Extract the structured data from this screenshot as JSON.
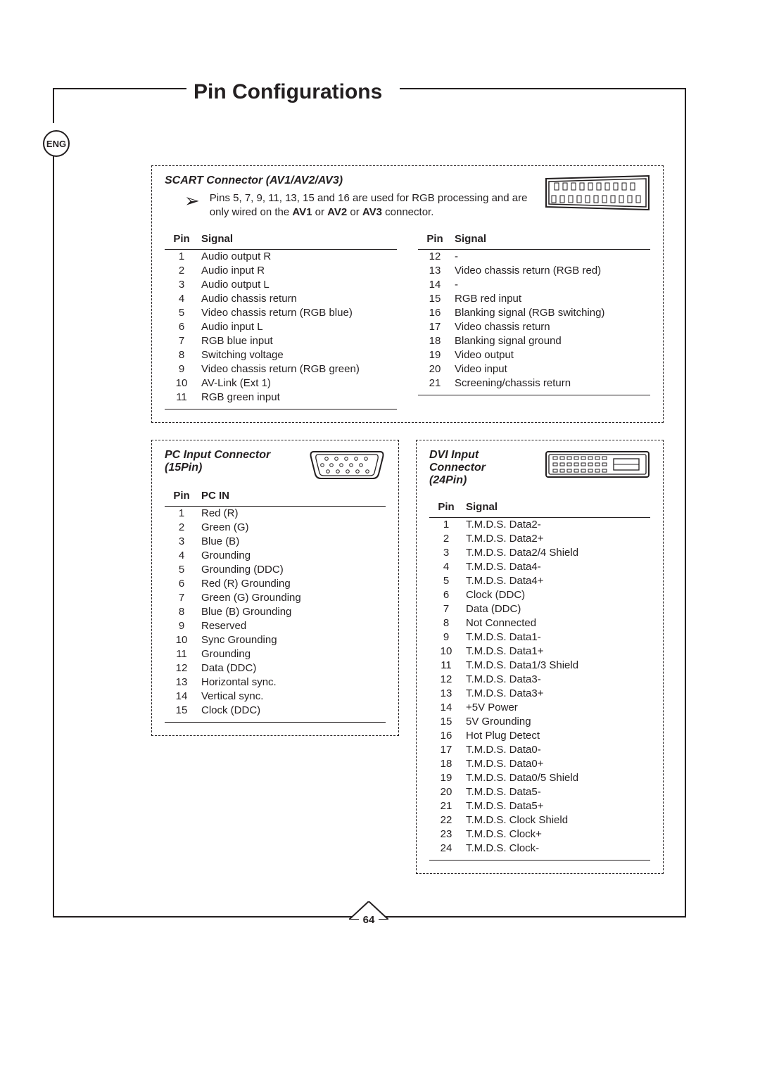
{
  "page_title": "Pin Configurations",
  "language_badge": "ENG",
  "page_number": "64",
  "scart": {
    "title": "SCART Connector (AV1/AV2/AV3)",
    "note_pre": "Pins 5, 7, 9, 11, 13, 15 and 16 are used for RGB processing and are only wired on the ",
    "note_bold1": "AV1",
    "note_mid1": " or ",
    "note_bold2": "AV2",
    "note_mid2": " or ",
    "note_bold3": "AV3",
    "note_post": " connector.",
    "hdr_pin": "Pin",
    "hdr_signal": "Signal",
    "left": [
      {
        "pin": "1",
        "sig": "Audio output R"
      },
      {
        "pin": "2",
        "sig": "Audio input R"
      },
      {
        "pin": "3",
        "sig": "Audio output L"
      },
      {
        "pin": "4",
        "sig": "Audio chassis return"
      },
      {
        "pin": "5",
        "sig": "Video chassis return (RGB blue)"
      },
      {
        "pin": "6",
        "sig": "Audio input L"
      },
      {
        "pin": "7",
        "sig": "RGB blue input"
      },
      {
        "pin": "8",
        "sig": "Switching voltage"
      },
      {
        "pin": "9",
        "sig": "Video chassis return (RGB green)"
      },
      {
        "pin": "10",
        "sig": "AV-Link (Ext 1)"
      },
      {
        "pin": "11",
        "sig": "RGB green input"
      }
    ],
    "right": [
      {
        "pin": "12",
        "sig": "-"
      },
      {
        "pin": "13",
        "sig": "Video chassis return (RGB red)"
      },
      {
        "pin": "14",
        "sig": "-"
      },
      {
        "pin": "15",
        "sig": "RGB red input"
      },
      {
        "pin": "16",
        "sig": "Blanking signal (RGB switching)"
      },
      {
        "pin": "17",
        "sig": "Video chassis return"
      },
      {
        "pin": "18",
        "sig": "Blanking signal ground"
      },
      {
        "pin": "19",
        "sig": "Video output"
      },
      {
        "pin": "20",
        "sig": "Video input"
      },
      {
        "pin": "21",
        "sig": "Screening/chassis return"
      }
    ]
  },
  "pc": {
    "title_l1": "PC Input Connector",
    "title_l2": "(15Pin)",
    "hdr_pin": "Pin",
    "hdr_signal": "PC IN",
    "rows": [
      {
        "pin": "1",
        "sig": "Red (R)"
      },
      {
        "pin": "2",
        "sig": "Green (G)"
      },
      {
        "pin": "3",
        "sig": "Blue (B)"
      },
      {
        "pin": "4",
        "sig": "Grounding"
      },
      {
        "pin": "5",
        "sig": "Grounding (DDC)"
      },
      {
        "pin": "6",
        "sig": "Red (R) Grounding"
      },
      {
        "pin": "7",
        "sig": "Green (G) Grounding"
      },
      {
        "pin": "8",
        "sig": "Blue (B) Grounding"
      },
      {
        "pin": "9",
        "sig": "Reserved"
      },
      {
        "pin": "10",
        "sig": "Sync Grounding"
      },
      {
        "pin": "11",
        "sig": "Grounding"
      },
      {
        "pin": "12",
        "sig": "Data (DDC)"
      },
      {
        "pin": "13",
        "sig": "Horizontal sync."
      },
      {
        "pin": "14",
        "sig": "Vertical sync."
      },
      {
        "pin": "15",
        "sig": "Clock (DDC)"
      }
    ]
  },
  "dvi": {
    "title_l1": "DVI Input Connector",
    "title_l2": "(24Pin)",
    "hdr_pin": "Pin",
    "hdr_signal": "Signal",
    "rows": [
      {
        "pin": "1",
        "sig": "T.M.D.S. Data2-"
      },
      {
        "pin": "2",
        "sig": "T.M.D.S. Data2+"
      },
      {
        "pin": "3",
        "sig": "T.M.D.S. Data2/4 Shield"
      },
      {
        "pin": "4",
        "sig": "T.M.D.S. Data4-"
      },
      {
        "pin": "5",
        "sig": "T.M.D.S. Data4+"
      },
      {
        "pin": "6",
        "sig": "Clock (DDC)"
      },
      {
        "pin": "7",
        "sig": "Data (DDC)"
      },
      {
        "pin": "8",
        "sig": "Not Connected"
      },
      {
        "pin": "9",
        "sig": "T.M.D.S. Data1-"
      },
      {
        "pin": "10",
        "sig": "T.M.D.S. Data1+"
      },
      {
        "pin": "11",
        "sig": "T.M.D.S. Data1/3 Shield"
      },
      {
        "pin": "12",
        "sig": "T.M.D.S. Data3-"
      },
      {
        "pin": "13",
        "sig": "T.M.D.S. Data3+"
      },
      {
        "pin": "14",
        "sig": "+5V Power"
      },
      {
        "pin": "15",
        "sig": "5V Grounding"
      },
      {
        "pin": "16",
        "sig": "Hot Plug Detect"
      },
      {
        "pin": "17",
        "sig": "T.M.D.S. Data0-"
      },
      {
        "pin": "18",
        "sig": "T.M.D.S. Data0+"
      },
      {
        "pin": "19",
        "sig": "T.M.D.S. Data0/5 Shield"
      },
      {
        "pin": "20",
        "sig": "T.M.D.S. Data5-"
      },
      {
        "pin": "21",
        "sig": "T.M.D.S. Data5+"
      },
      {
        "pin": "22",
        "sig": "T.M.D.S. Clock Shield"
      },
      {
        "pin": "23",
        "sig": "T.M.D.S. Clock+"
      },
      {
        "pin": "24",
        "sig": "T.M.D.S. Clock-"
      }
    ]
  }
}
